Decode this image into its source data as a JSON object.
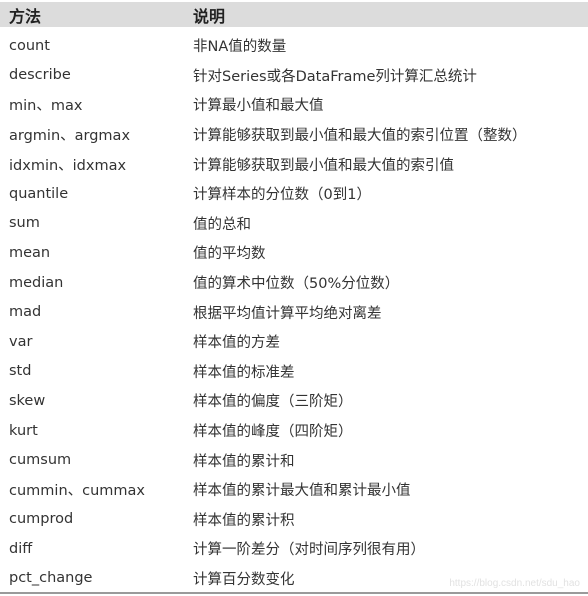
{
  "table": {
    "headers": {
      "method": "方法",
      "description": "说明"
    },
    "rows": [
      {
        "method": "count",
        "description": "非NA值的数量"
      },
      {
        "method": "describe",
        "description": "针对Series或各DataFrame列计算汇总统计"
      },
      {
        "method": "min、max",
        "description": "计算最小值和最大值"
      },
      {
        "method": "argmin、argmax",
        "description": "计算能够获取到最小值和最大值的索引位置（整数）"
      },
      {
        "method": "idxmin、idxmax",
        "description": "计算能够获取到最小值和最大值的索引值"
      },
      {
        "method": "quantile",
        "description": "计算样本的分位数（0到1）"
      },
      {
        "method": "sum",
        "description": "值的总和"
      },
      {
        "method": "mean",
        "description": "值的平均数"
      },
      {
        "method": "median",
        "description": "值的算术中位数（50%分位数）"
      },
      {
        "method": "mad",
        "description": "根据平均值计算平均绝对离差"
      },
      {
        "method": "var",
        "description": "样本值的方差"
      },
      {
        "method": "std",
        "description": "样本值的标准差"
      },
      {
        "method": "skew",
        "description": "样本值的偏度（三阶矩）"
      },
      {
        "method": "kurt",
        "description": "样本值的峰度（四阶矩）"
      },
      {
        "method": "cumsum",
        "description": "样本值的累计和"
      },
      {
        "method": "cummin、cummax",
        "description": "样本值的累计最大值和累计最小值"
      },
      {
        "method": "cumprod",
        "description": "样本值的累计积"
      },
      {
        "method": "diff",
        "description": "计算一阶差分（对时间序列很有用）"
      },
      {
        "method": "pct_change",
        "description": "计算百分数变化"
      }
    ]
  },
  "watermark": "https://blog.csdn.net/sdu_hao"
}
